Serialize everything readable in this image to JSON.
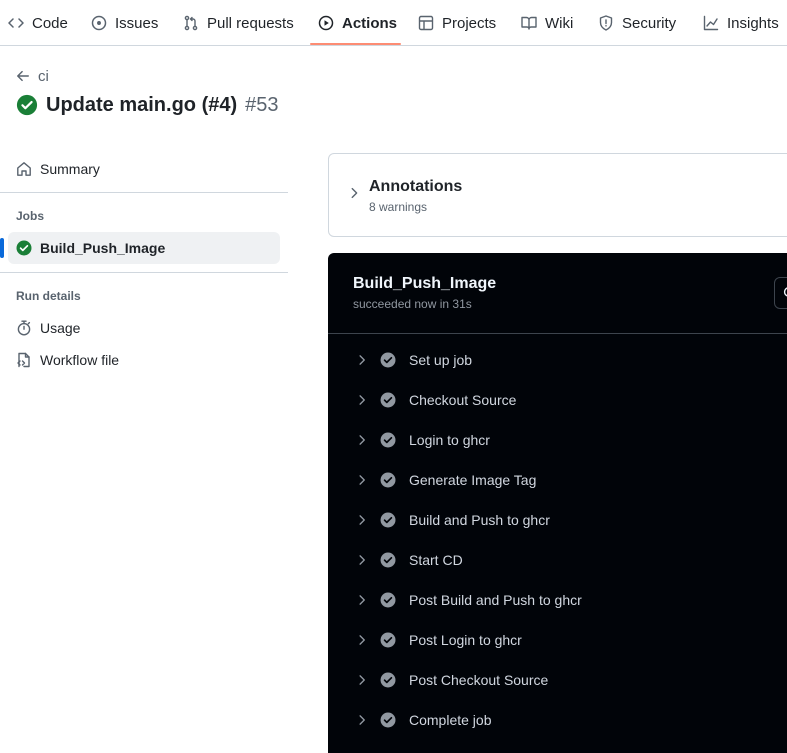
{
  "nav": {
    "tabs": [
      {
        "label": "Code",
        "icon": "code-icon",
        "active": false
      },
      {
        "label": "Issues",
        "icon": "issue-opened-icon",
        "active": false
      },
      {
        "label": "Pull requests",
        "icon": "git-pull-request-icon",
        "active": false
      },
      {
        "label": "Actions",
        "icon": "play-icon",
        "active": true
      },
      {
        "label": "Projects",
        "icon": "table-icon",
        "active": false
      },
      {
        "label": "Wiki",
        "icon": "book-icon",
        "active": false
      },
      {
        "label": "Security",
        "icon": "shield-icon",
        "active": false
      },
      {
        "label": "Insights",
        "icon": "graph-icon",
        "active": false
      }
    ]
  },
  "header": {
    "back_label": "ci",
    "title": "Update main.go (#4)",
    "run_number": "#53",
    "status": "success"
  },
  "sidebar": {
    "summary_label": "Summary",
    "jobs_heading": "Jobs",
    "jobs": [
      {
        "label": "Build_Push_Image",
        "status": "success",
        "selected": true
      }
    ],
    "run_details_heading": "Run details",
    "usage_label": "Usage",
    "workflow_file_label": "Workflow file"
  },
  "annotations": {
    "title": "Annotations",
    "summary": "8 warnings"
  },
  "job": {
    "name": "Build_Push_Image",
    "status_text": "succeeded now in 31s",
    "steps": [
      {
        "label": "Set up job",
        "status": "success"
      },
      {
        "label": "Checkout Source",
        "status": "success"
      },
      {
        "label": "Login to ghcr",
        "status": "success"
      },
      {
        "label": "Generate Image Tag",
        "status": "success"
      },
      {
        "label": "Build and Push to ghcr",
        "status": "success"
      },
      {
        "label": "Start CD",
        "status": "success"
      },
      {
        "label": "Post Build and Push to ghcr",
        "status": "success"
      },
      {
        "label": "Post Login to ghcr",
        "status": "success"
      },
      {
        "label": "Post Checkout Source",
        "status": "success"
      },
      {
        "label": "Complete job",
        "status": "success"
      }
    ]
  },
  "colors": {
    "accent_underline": "#fd8c73",
    "success_green": "#1a7f37",
    "selection_blue": "#0969da",
    "log_background": "#010409"
  }
}
